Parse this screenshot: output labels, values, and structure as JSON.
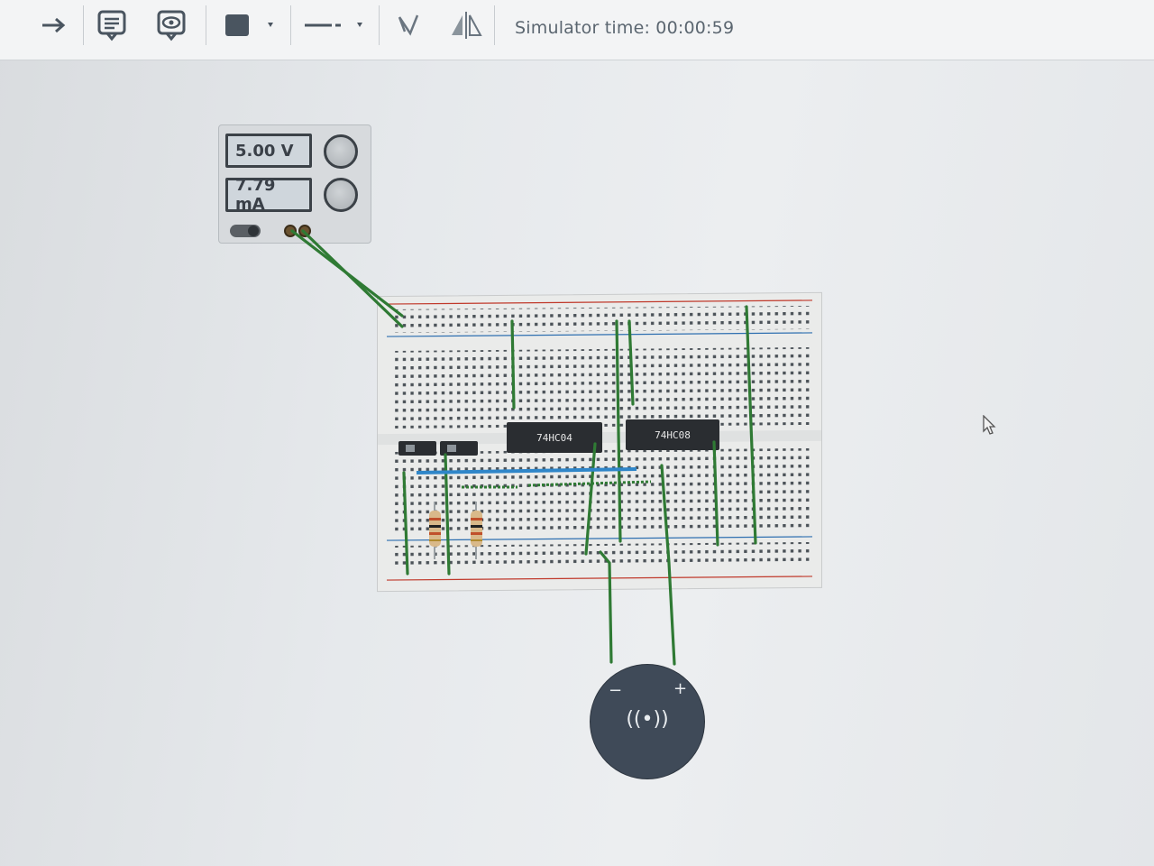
{
  "toolbar": {
    "simulator_time": "Simulator time: 00:00:59",
    "icons": [
      "arrow-right-icon",
      "note-icon",
      "eye-icon",
      "color-swatch-icon",
      "line-style-icon",
      "rotate-icon",
      "mirror-icon"
    ]
  },
  "power_supply": {
    "voltage": "5.00 V",
    "current": "7.79 mA"
  },
  "chips": [
    {
      "label": "74HC04"
    },
    {
      "label": "74HC08"
    }
  ],
  "buzzer": {
    "minus": "−",
    "plus": "+",
    "symbol": "((•))"
  },
  "colors": {
    "wire": "#2f7a34",
    "rail_red": "#c0392b",
    "rail_blue": "#2e6fb0",
    "chip": "#2a2d31",
    "buzzer": "#3f4a58"
  }
}
